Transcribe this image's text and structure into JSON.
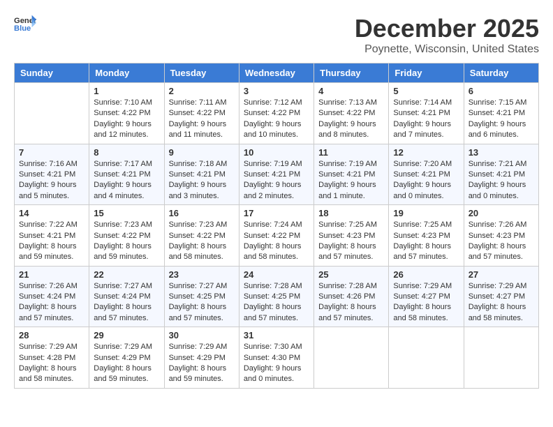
{
  "header": {
    "logo_general": "General",
    "logo_blue": "Blue",
    "month": "December 2025",
    "location": "Poynette, Wisconsin, United States"
  },
  "days_of_week": [
    "Sunday",
    "Monday",
    "Tuesday",
    "Wednesday",
    "Thursday",
    "Friday",
    "Saturday"
  ],
  "weeks": [
    [
      {
        "day": "",
        "content": ""
      },
      {
        "day": "1",
        "content": "Sunrise: 7:10 AM\nSunset: 4:22 PM\nDaylight: 9 hours\nand 12 minutes."
      },
      {
        "day": "2",
        "content": "Sunrise: 7:11 AM\nSunset: 4:22 PM\nDaylight: 9 hours\nand 11 minutes."
      },
      {
        "day": "3",
        "content": "Sunrise: 7:12 AM\nSunset: 4:22 PM\nDaylight: 9 hours\nand 10 minutes."
      },
      {
        "day": "4",
        "content": "Sunrise: 7:13 AM\nSunset: 4:22 PM\nDaylight: 9 hours\nand 8 minutes."
      },
      {
        "day": "5",
        "content": "Sunrise: 7:14 AM\nSunset: 4:21 PM\nDaylight: 9 hours\nand 7 minutes."
      },
      {
        "day": "6",
        "content": "Sunrise: 7:15 AM\nSunset: 4:21 PM\nDaylight: 9 hours\nand 6 minutes."
      }
    ],
    [
      {
        "day": "7",
        "content": "Sunrise: 7:16 AM\nSunset: 4:21 PM\nDaylight: 9 hours\nand 5 minutes."
      },
      {
        "day": "8",
        "content": "Sunrise: 7:17 AM\nSunset: 4:21 PM\nDaylight: 9 hours\nand 4 minutes."
      },
      {
        "day": "9",
        "content": "Sunrise: 7:18 AM\nSunset: 4:21 PM\nDaylight: 9 hours\nand 3 minutes."
      },
      {
        "day": "10",
        "content": "Sunrise: 7:19 AM\nSunset: 4:21 PM\nDaylight: 9 hours\nand 2 minutes."
      },
      {
        "day": "11",
        "content": "Sunrise: 7:19 AM\nSunset: 4:21 PM\nDaylight: 9 hours\nand 1 minute."
      },
      {
        "day": "12",
        "content": "Sunrise: 7:20 AM\nSunset: 4:21 PM\nDaylight: 9 hours\nand 0 minutes."
      },
      {
        "day": "13",
        "content": "Sunrise: 7:21 AM\nSunset: 4:21 PM\nDaylight: 9 hours\nand 0 minutes."
      }
    ],
    [
      {
        "day": "14",
        "content": "Sunrise: 7:22 AM\nSunset: 4:21 PM\nDaylight: 8 hours\nand 59 minutes."
      },
      {
        "day": "15",
        "content": "Sunrise: 7:23 AM\nSunset: 4:22 PM\nDaylight: 8 hours\nand 59 minutes."
      },
      {
        "day": "16",
        "content": "Sunrise: 7:23 AM\nSunset: 4:22 PM\nDaylight: 8 hours\nand 58 minutes."
      },
      {
        "day": "17",
        "content": "Sunrise: 7:24 AM\nSunset: 4:22 PM\nDaylight: 8 hours\nand 58 minutes."
      },
      {
        "day": "18",
        "content": "Sunrise: 7:25 AM\nSunset: 4:23 PM\nDaylight: 8 hours\nand 57 minutes."
      },
      {
        "day": "19",
        "content": "Sunrise: 7:25 AM\nSunset: 4:23 PM\nDaylight: 8 hours\nand 57 minutes."
      },
      {
        "day": "20",
        "content": "Sunrise: 7:26 AM\nSunset: 4:23 PM\nDaylight: 8 hours\nand 57 minutes."
      }
    ],
    [
      {
        "day": "21",
        "content": "Sunrise: 7:26 AM\nSunset: 4:24 PM\nDaylight: 8 hours\nand 57 minutes."
      },
      {
        "day": "22",
        "content": "Sunrise: 7:27 AM\nSunset: 4:24 PM\nDaylight: 8 hours\nand 57 minutes."
      },
      {
        "day": "23",
        "content": "Sunrise: 7:27 AM\nSunset: 4:25 PM\nDaylight: 8 hours\nand 57 minutes."
      },
      {
        "day": "24",
        "content": "Sunrise: 7:28 AM\nSunset: 4:25 PM\nDaylight: 8 hours\nand 57 minutes."
      },
      {
        "day": "25",
        "content": "Sunrise: 7:28 AM\nSunset: 4:26 PM\nDaylight: 8 hours\nand 57 minutes."
      },
      {
        "day": "26",
        "content": "Sunrise: 7:29 AM\nSunset: 4:27 PM\nDaylight: 8 hours\nand 58 minutes."
      },
      {
        "day": "27",
        "content": "Sunrise: 7:29 AM\nSunset: 4:27 PM\nDaylight: 8 hours\nand 58 minutes."
      }
    ],
    [
      {
        "day": "28",
        "content": "Sunrise: 7:29 AM\nSunset: 4:28 PM\nDaylight: 8 hours\nand 58 minutes."
      },
      {
        "day": "29",
        "content": "Sunrise: 7:29 AM\nSunset: 4:29 PM\nDaylight: 8 hours\nand 59 minutes."
      },
      {
        "day": "30",
        "content": "Sunrise: 7:29 AM\nSunset: 4:29 PM\nDaylight: 8 hours\nand 59 minutes."
      },
      {
        "day": "31",
        "content": "Sunrise: 7:30 AM\nSunset: 4:30 PM\nDaylight: 9 hours\nand 0 minutes."
      },
      {
        "day": "",
        "content": ""
      },
      {
        "day": "",
        "content": ""
      },
      {
        "day": "",
        "content": ""
      }
    ]
  ]
}
